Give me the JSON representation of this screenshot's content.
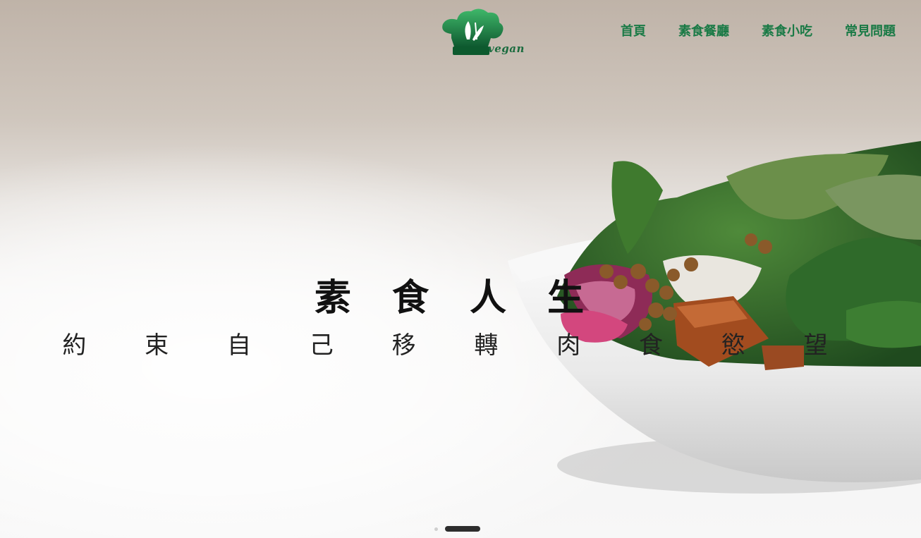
{
  "header": {
    "logo_text": "vegan",
    "nav": [
      {
        "label": "首頁"
      },
      {
        "label": "素食餐廳"
      },
      {
        "label": "素食小吃"
      },
      {
        "label": "常見問題"
      }
    ]
  },
  "hero": {
    "title": "素 食 人 生",
    "subtitle": "約 束 自 己 移 轉 肉 食 慾 望"
  },
  "carousel": {
    "slide_count": 2,
    "active_index": 1
  },
  "colors": {
    "brand_green": "#1a7a46",
    "text_dark": "#111111",
    "indicator_active": "#2d2d2d",
    "indicator_inactive": "#cfcfcf"
  }
}
